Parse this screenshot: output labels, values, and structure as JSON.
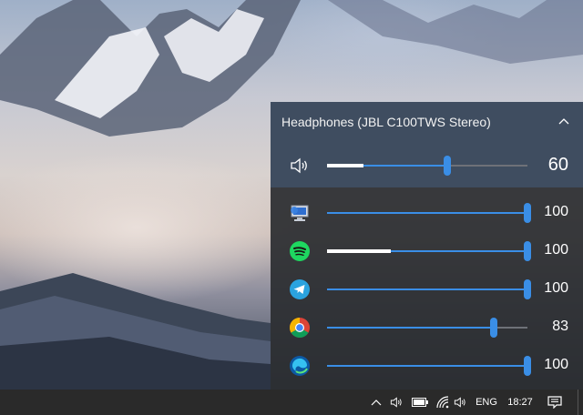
{
  "flyout": {
    "device_title": "Headphones (JBL C100TWS Stereo)",
    "collapse_icon": "chevron-up-icon",
    "master": {
      "icon": "speaker-icon",
      "volume": 60,
      "peak": 0.18,
      "display": "60"
    },
    "apps": [
      {
        "name": "system-sounds",
        "icon": "system-sounds-icon",
        "volume": 100,
        "peak": 0,
        "display": "100"
      },
      {
        "name": "spotify",
        "icon": "spotify-icon",
        "volume": 100,
        "peak": 0.32,
        "display": "100"
      },
      {
        "name": "telegram",
        "icon": "telegram-icon",
        "volume": 100,
        "peak": 0,
        "display": "100"
      },
      {
        "name": "chrome",
        "icon": "chrome-icon",
        "volume": 83,
        "peak": 0,
        "display": "83"
      },
      {
        "name": "edge",
        "icon": "edge-icon",
        "volume": 100,
        "peak": 0,
        "display": "100"
      }
    ]
  },
  "taskbar": {
    "icons": [
      "chevron-up-icon",
      "speaker-icon",
      "battery-icon",
      "wifi-icon",
      "speaker-icon"
    ],
    "language": "ENG",
    "time": "18:27",
    "notification_icon": "action-center-icon"
  },
  "colors": {
    "accent": "#3a8ee6",
    "header_bg": "#404e62",
    "panel_bg": "#2a2c30",
    "taskbar_bg": "#2a2a2a"
  }
}
